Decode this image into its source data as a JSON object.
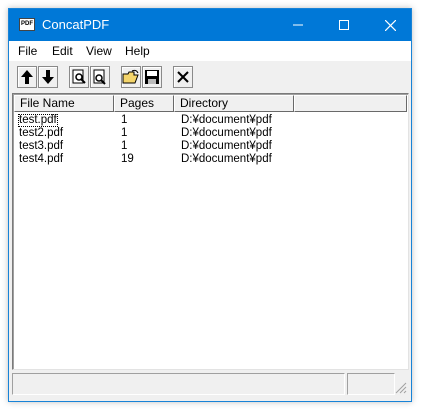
{
  "window": {
    "title": "ConcatPDF",
    "app_icon_text": "PDF"
  },
  "menu": [
    "File",
    "Edit",
    "View",
    "Help"
  ],
  "toolbar": {
    "buttons": [
      "move-up-icon",
      "move-down-icon",
      "preview-icon",
      "page-view-icon",
      "open-folder-icon",
      "save-icon",
      "delete-icon"
    ]
  },
  "list": {
    "columns": [
      "File Name",
      "Pages",
      "Directory"
    ],
    "rows": [
      {
        "name": "test.pdf",
        "pages": "1",
        "dir": "D:¥document¥pdf"
      },
      {
        "name": "test2.pdf",
        "pages": "1",
        "dir": "D:¥document¥pdf"
      },
      {
        "name": "test3.pdf",
        "pages": "1",
        "dir": "D:¥document¥pdf"
      },
      {
        "name": "test4.pdf",
        "pages": "19",
        "dir": "D:¥document¥pdf"
      }
    ]
  },
  "colors": {
    "titlebar": "#0078d7",
    "window_bg": "#f0f0f0"
  }
}
